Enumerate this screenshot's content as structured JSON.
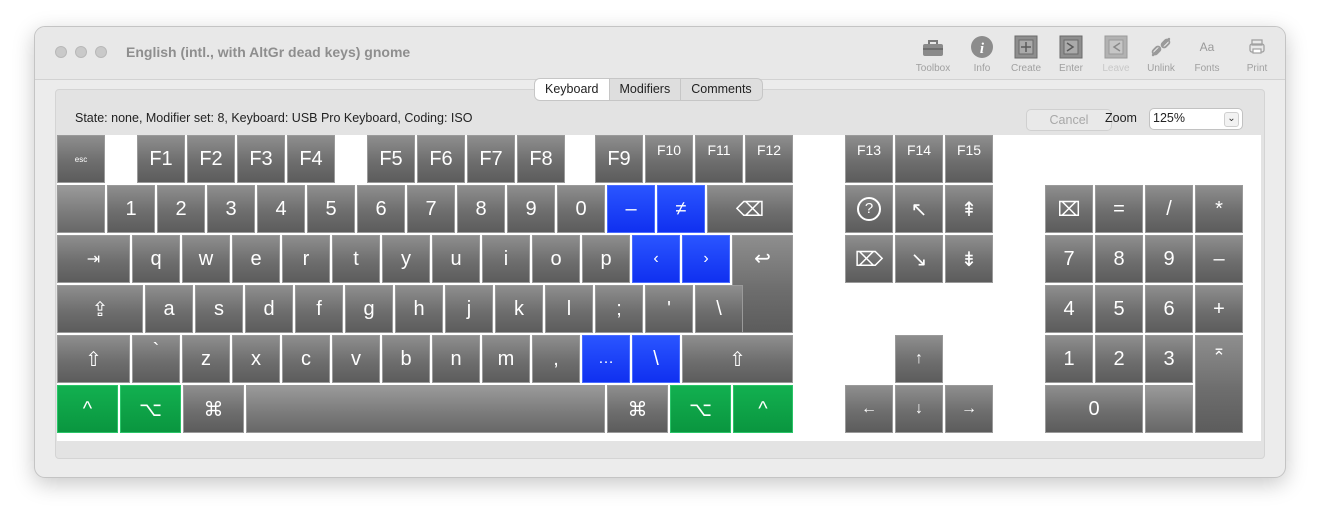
{
  "window": {
    "title": "English (intl., with AltGr dead keys) gnome"
  },
  "toolbar": [
    {
      "label": "Toolbox",
      "icon": "toolbox-icon",
      "enabled": true
    },
    {
      "label": "Info",
      "icon": "info-icon",
      "enabled": true
    },
    {
      "label": "Create",
      "icon": "create-icon",
      "enabled": true
    },
    {
      "label": "Enter",
      "icon": "enter-icon",
      "enabled": true
    },
    {
      "label": "Leave",
      "icon": "leave-icon",
      "enabled": false
    },
    {
      "label": "Unlink",
      "icon": "unlink-icon",
      "enabled": true
    },
    {
      "label": "Fonts",
      "icon": "fonts-icon",
      "enabled": true,
      "glyph": "Aa"
    },
    {
      "label": "Print",
      "icon": "print-icon",
      "enabled": true
    }
  ],
  "tabs": [
    {
      "label": "Keyboard",
      "active": true
    },
    {
      "label": "Modifiers",
      "active": false
    },
    {
      "label": "Comments",
      "active": false
    }
  ],
  "status": {
    "text": "State: none, Modifier set: 8, Keyboard: USB Pro Keyboard, Coding: ISO"
  },
  "controls": {
    "cancel_label": "Cancel",
    "zoom_label": "Zoom",
    "zoom_value": "125%"
  },
  "colors": {
    "blue_key": "#1234f5",
    "green_key": "#0ea346",
    "key_gray": "#707070"
  },
  "keys": {
    "esc": "esc",
    "f1": "F1",
    "f2": "F2",
    "f3": "F3",
    "f4": "F4",
    "f5": "F5",
    "f6": "F6",
    "f7": "F7",
    "f8": "F8",
    "f9": "F9",
    "f10": "F10",
    "f11": "F11",
    "f12": "F12",
    "f13": "F13",
    "f14": "F14",
    "f15": "F15",
    "grave": "",
    "n1": "1",
    "n2": "2",
    "n3": "3",
    "n4": "4",
    "n5": "5",
    "n6": "6",
    "n7": "7",
    "n8": "8",
    "n9": "9",
    "n0": "0",
    "minus": "–",
    "equal": "≠",
    "delete": "⌫",
    "tab": "⇥",
    "q": "q",
    "w": "w",
    "e": "e",
    "r": "r",
    "t": "t",
    "y": "y",
    "u": "u",
    "i": "i",
    "o": "o",
    "p": "p",
    "lbracket": "‹",
    "rbracket": "›",
    "return": "↩",
    "caps": "⇪",
    "a": "a",
    "s": "s",
    "d": "d",
    "f": "f",
    "g": "g",
    "h": "h",
    "j": "j",
    "k": "k",
    "l": "l",
    "semicolon": ";",
    "quote": "'",
    "backslash": "\\",
    "lshift": "⇧",
    "iso": "`",
    "z": "z",
    "x": "x",
    "c": "c",
    "v": "v",
    "b": "b",
    "n": "n",
    "m": "m",
    "comma": ",",
    "period": "…",
    "slash": "\\",
    "rshift": "⇧",
    "lctrl": "^",
    "lopt": "⌥",
    "lcmd": "⌘",
    "space": "",
    "rcmd": "⌘",
    "ropt": "⌥",
    "rctrl": "^",
    "help": "?",
    "home": "↖",
    "pgup": "⇞",
    "fwddel": "⌦",
    "end": "↘",
    "pgdn": "⇟",
    "up": "↑",
    "left": "←",
    "down": "↓",
    "right": "→",
    "clear": "⌧",
    "kp_equal": "=",
    "kp_div": "/",
    "kp_mul": "*",
    "kp7": "7",
    "kp8": "8",
    "kp9": "9",
    "kp_minus": "–",
    "kp4": "4",
    "kp5": "5",
    "kp6": "6",
    "kp_plus": "+",
    "kp1": "1",
    "kp2": "2",
    "kp3": "3",
    "kp_enter": "⌅",
    "kp0": "0",
    "kp_dot": ""
  }
}
